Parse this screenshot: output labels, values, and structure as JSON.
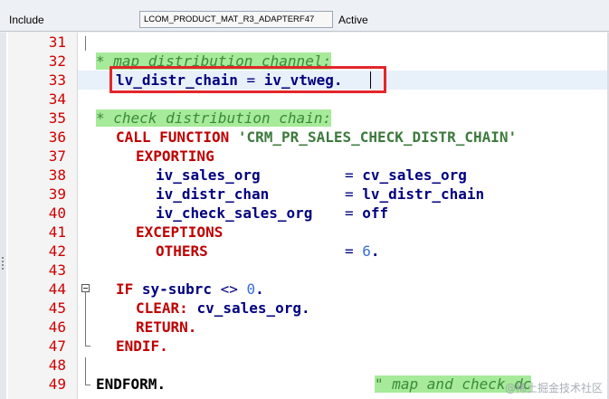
{
  "header": {
    "include_label": "Include",
    "program_name": "LCOM_PRODUCT_MAT_R3_ADAPTERF47",
    "status": "Active"
  },
  "editor": {
    "lines": [
      {
        "num": "31"
      },
      {
        "num": "32",
        "comment": "* map distribution channel:"
      },
      {
        "num": "33",
        "var": "lv_distr_chain",
        "op": " = ",
        "val": "iv_vtweg",
        "end": "."
      },
      {
        "num": "34"
      },
      {
        "num": "35",
        "comment": "* check distribution chain:"
      },
      {
        "num": "36",
        "kw": "CALL FUNCTION",
        "str": "'CRM_PR_SALES_CHECK_DISTR_CHAIN'"
      },
      {
        "num": "37",
        "kw": "EXPORTING"
      },
      {
        "num": "38",
        "param": "iv_sales_org",
        "op": "= ",
        "val": "cv_sales_org"
      },
      {
        "num": "39",
        "param": "iv_distr_chan",
        "op": "= ",
        "val": "lv_distr_chain"
      },
      {
        "num": "40",
        "param": "iv_check_sales_org",
        "op": "= ",
        "val": "off"
      },
      {
        "num": "41",
        "kw": "EXCEPTIONS"
      },
      {
        "num": "42",
        "kw": "OTHERS",
        "op": "= ",
        "numval": "6",
        "end": "."
      },
      {
        "num": "43"
      },
      {
        "num": "44",
        "kw": "IF",
        "var": "sy-subrc",
        "op": " <> ",
        "numval": "0",
        "end": "."
      },
      {
        "num": "45",
        "kw": "CLEAR:",
        "val": "cv_sales_org",
        "end": "."
      },
      {
        "num": "46",
        "kw": "RETURN",
        "end": "."
      },
      {
        "num": "47",
        "kw": "ENDIF",
        "end": "."
      },
      {
        "num": "48"
      },
      {
        "num": "49",
        "kw": "ENDFORM",
        "end": ".",
        "comment": "\" map and check dc"
      }
    ]
  },
  "watermark": "@稀土掘金技术社区",
  "colors": {
    "line_number": "#d00000",
    "keyword": "#c00000",
    "identifier": "#000080",
    "string": "#3d7a3d",
    "number": "#3a6fd8",
    "comment_bg": "#a6ea9a",
    "highlight_border": "#e3262b"
  }
}
